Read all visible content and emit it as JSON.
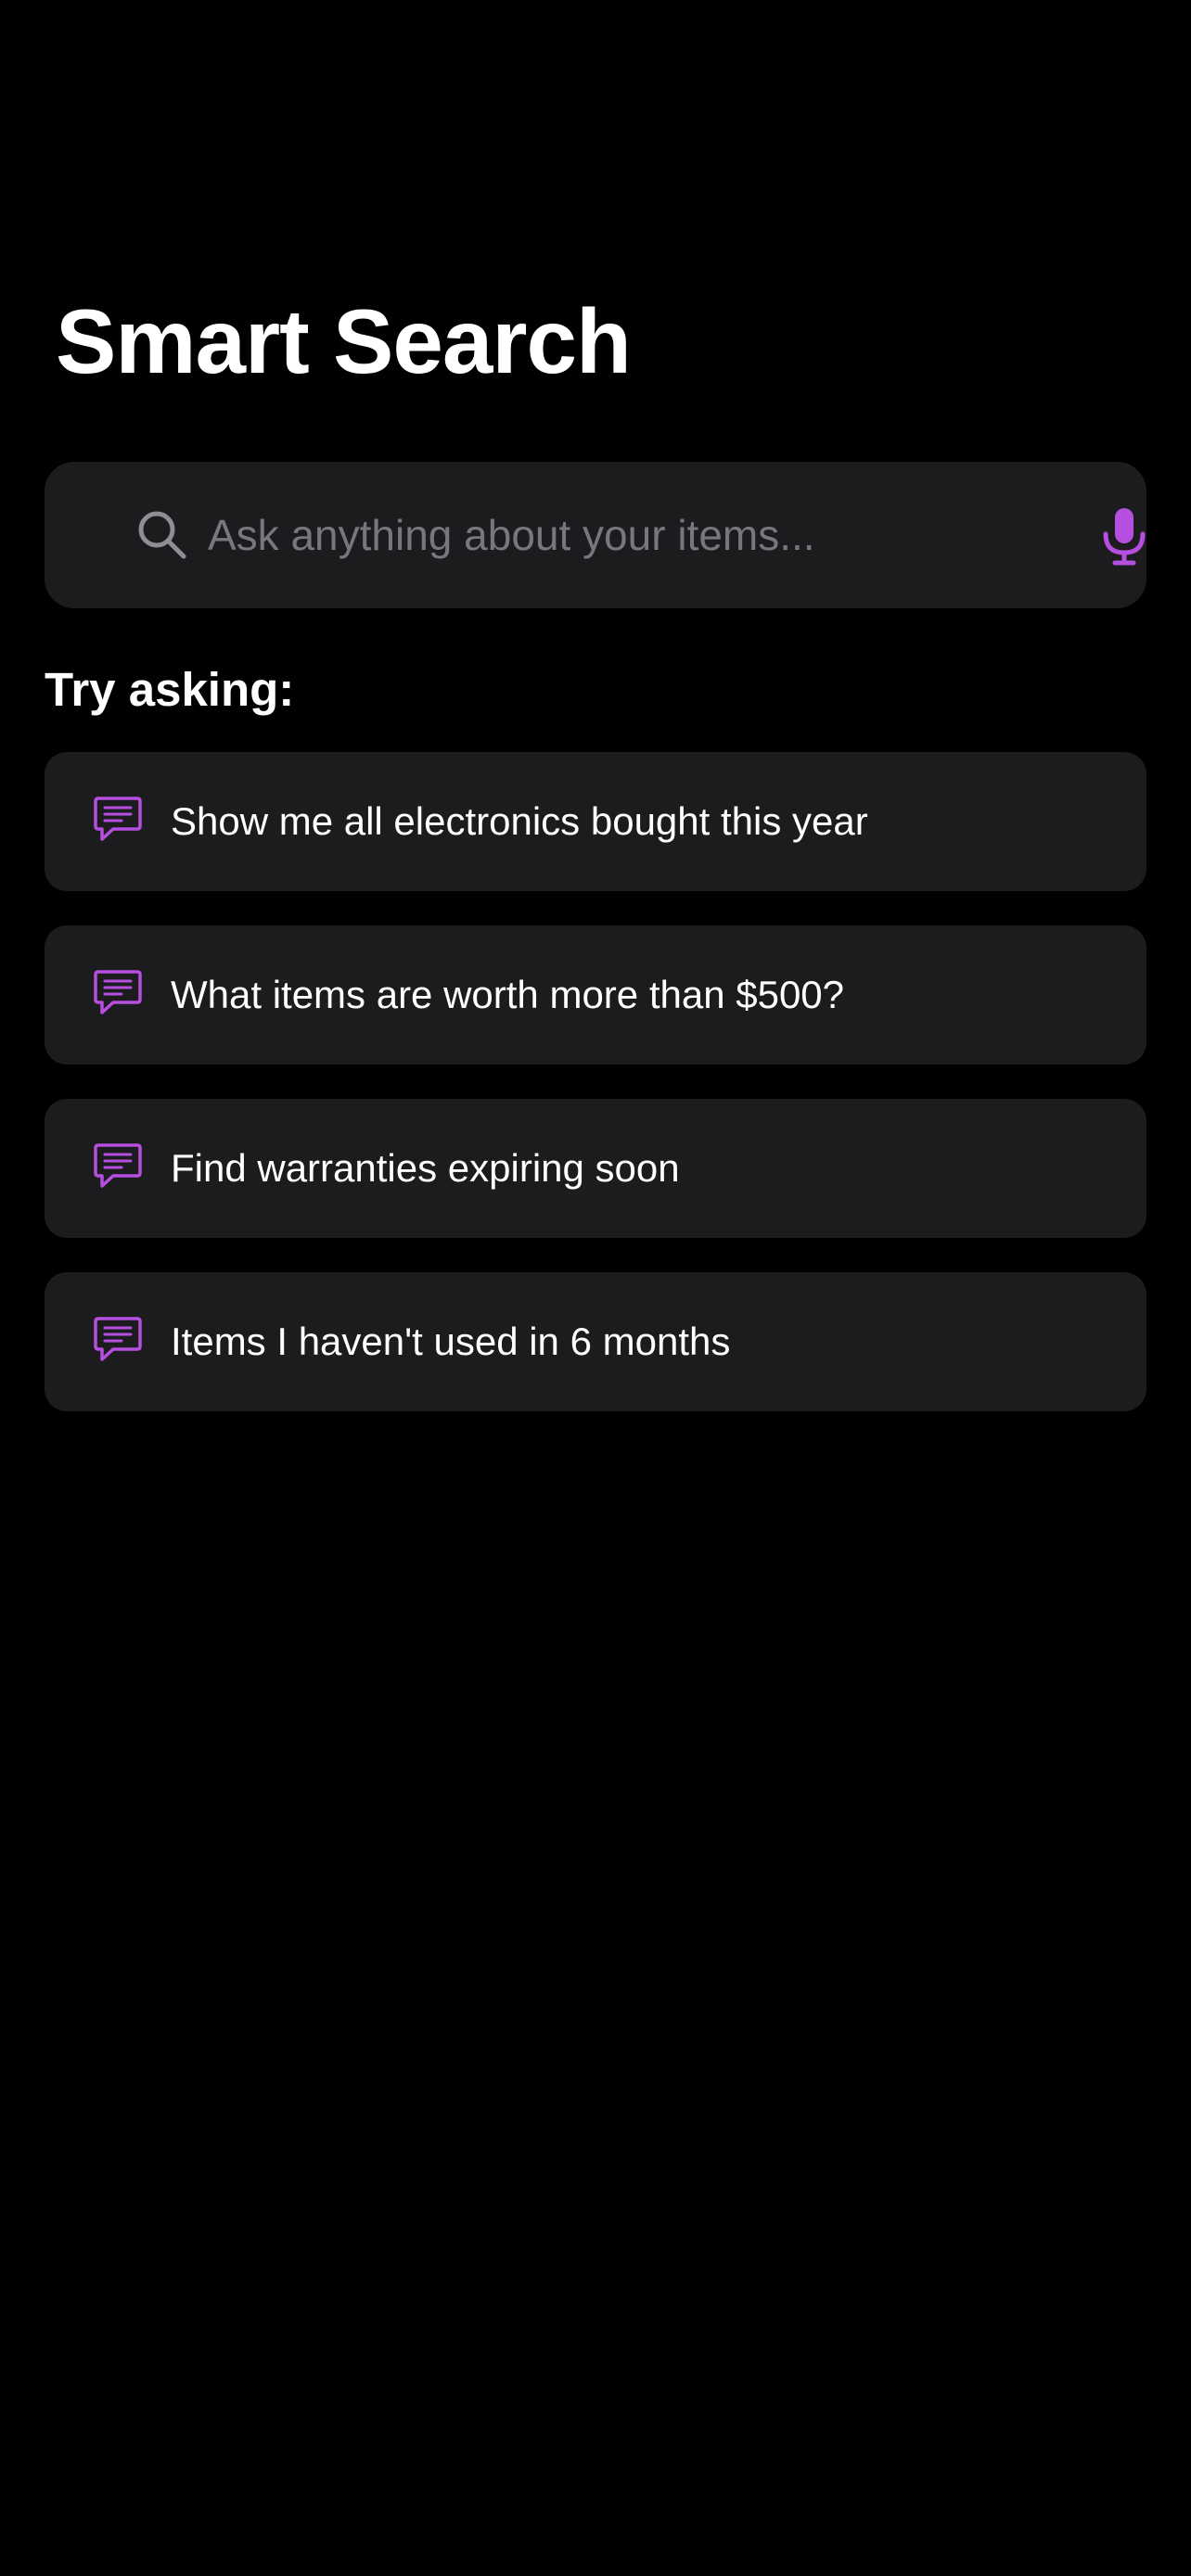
{
  "header": {
    "title": "Smart Search"
  },
  "search": {
    "placeholder": "Ask anything about your items...",
    "value": ""
  },
  "suggestions_section": {
    "heading": "Try asking:",
    "items": [
      {
        "label": "Show me all electronics bought this year",
        "icon": "chat-bubble-icon"
      },
      {
        "label": "What items are worth more than $500?",
        "icon": "chat-bubble-icon"
      },
      {
        "label": "Find warranties expiring soon",
        "icon": "chat-bubble-icon"
      },
      {
        "label": "Items I haven't used in 6 months",
        "icon": "chat-bubble-icon"
      }
    ]
  },
  "colors": {
    "background": "#000000",
    "card": "#1c1c1e",
    "accent": "#b64fe0",
    "placeholder": "#77777c",
    "search_icon": "#8e8e93"
  }
}
